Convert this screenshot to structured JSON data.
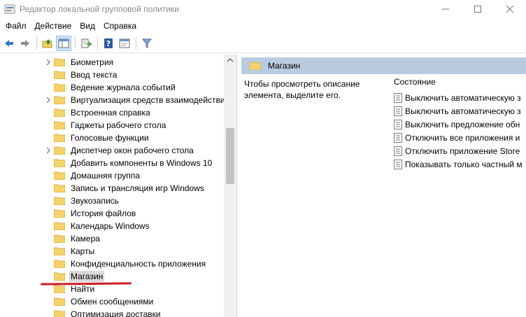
{
  "window": {
    "title": "Редактор локальной групповой политики"
  },
  "menu": [
    "Файл",
    "Действие",
    "Вид",
    "Справка"
  ],
  "tree": {
    "items": [
      {
        "label": "Биометрия",
        "expandable": true
      },
      {
        "label": "Ввод текста",
        "expandable": false
      },
      {
        "label": "Ведение журнала событий",
        "expandable": false
      },
      {
        "label": "Виртуализация средств взаимодействия",
        "expandable": true
      },
      {
        "label": "Встроенная справка",
        "expandable": false
      },
      {
        "label": "Гаджеты рабочего стола",
        "expandable": false
      },
      {
        "label": "Голосовые функции",
        "expandable": false
      },
      {
        "label": "Диспетчер окон рабочего стола",
        "expandable": true
      },
      {
        "label": "Добавить компоненты в Windows 10",
        "expandable": false
      },
      {
        "label": "Домашняя группа",
        "expandable": false
      },
      {
        "label": "Запись и трансляция игр Windows",
        "expandable": false
      },
      {
        "label": "Звукозапись",
        "expandable": false
      },
      {
        "label": "История файлов",
        "expandable": false
      },
      {
        "label": "Календарь Windows",
        "expandable": false
      },
      {
        "label": "Камера",
        "expandable": false
      },
      {
        "label": "Карты",
        "expandable": false
      },
      {
        "label": "Конфиденциальность приложения",
        "expandable": false
      },
      {
        "label": "Магазин",
        "expandable": false,
        "selected": true
      },
      {
        "label": "Найти",
        "expandable": false
      },
      {
        "label": "Обмен сообщениями",
        "expandable": false
      },
      {
        "label": "Оптимизация доставки",
        "expandable": false
      }
    ]
  },
  "right_pane": {
    "header_title": "Магазин",
    "description": "Чтобы просмотреть описание элемента, выделите его.",
    "column_header": "Состояние",
    "settings": [
      "Выключить автоматическую з",
      "Выключить автоматическую з",
      "Выключить предложение обн",
      "Отключить все приложения и",
      "Отключить приложение Store",
      "Показывать только частный м"
    ]
  },
  "colors": {
    "header_bg": "#b9cbe1",
    "selection_bg": "#d9d9d9",
    "annotation_red": "#cc1f1f",
    "folder_yellow": "#f5d36b"
  },
  "icons": {
    "toolbar": [
      "back-arrow-icon",
      "forward-arrow-icon",
      "up-folder-icon",
      "show-hide-tree-icon",
      "export-list-icon",
      "help-icon",
      "properties-icon",
      "filter-icon"
    ]
  }
}
